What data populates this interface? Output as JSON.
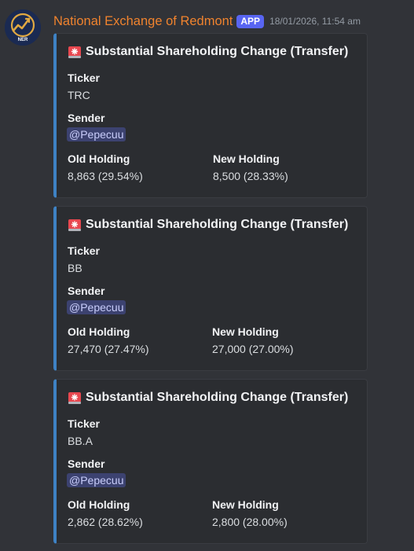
{
  "message": {
    "username": "National Exchange of Redmont",
    "badge": "APP",
    "timestamp": "18/01/2026, 11:54 am",
    "avatar_text": "NER"
  },
  "colors": {
    "username": "#f0832e",
    "badge_bg": "#5865f2",
    "embed_accent": "#3e82c4",
    "mention_bg": "#3c4270",
    "mention_text": "#c9cdfb",
    "avatar_gold": "#e0a842"
  },
  "embeds": [
    {
      "icon": "siren-icon",
      "title": "Substantial Shareholding Change (Transfer)",
      "ticker_label": "Ticker",
      "ticker": "TRC",
      "sender_label": "Sender",
      "sender": "@Pepecuu",
      "old_label": "Old Holding",
      "old_holding": "8,863 (29.54%)",
      "new_label": "New Holding",
      "new_holding": "8,500 (28.33%)"
    },
    {
      "icon": "siren-icon",
      "title": "Substantial Shareholding Change (Transfer)",
      "ticker_label": "Ticker",
      "ticker": "BB",
      "sender_label": "Sender",
      "sender": "@Pepecuu",
      "old_label": "Old Holding",
      "old_holding": "27,470 (27.47%)",
      "new_label": "New Holding",
      "new_holding": "27,000 (27.00%)"
    },
    {
      "icon": "siren-icon",
      "title": "Substantial Shareholding Change (Transfer)",
      "ticker_label": "Ticker",
      "ticker": "BB.A",
      "sender_label": "Sender",
      "sender": "@Pepecuu",
      "old_label": "Old Holding",
      "old_holding": "2,862 (28.62%)",
      "new_label": "New Holding",
      "new_holding": "2,800 (28.00%)"
    }
  ]
}
